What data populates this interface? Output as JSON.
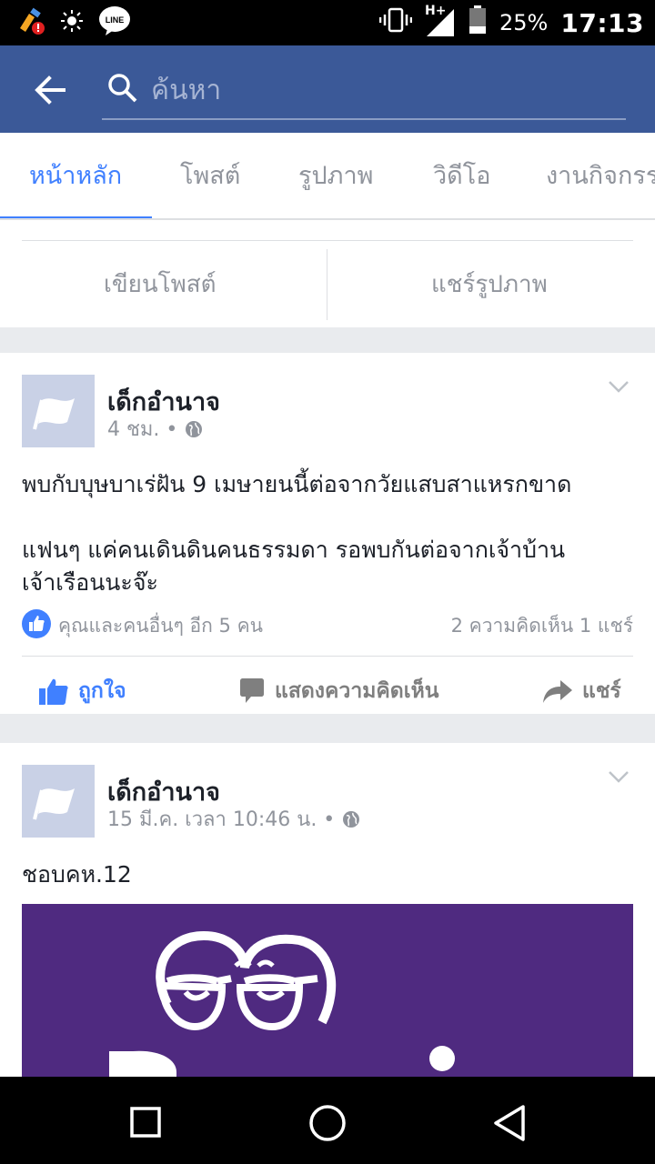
{
  "status_bar": {
    "battery": "25%",
    "time": "17:13",
    "network": "H+",
    "line_badge": "LINE"
  },
  "search": {
    "placeholder": "ค้นหา"
  },
  "tabs": [
    {
      "label": "หน้าหลัก",
      "active": true
    },
    {
      "label": "โพสต์",
      "active": false
    },
    {
      "label": "รูปภาพ",
      "active": false
    },
    {
      "label": "วิดีโอ",
      "active": false
    },
    {
      "label": "งานกิจกรร",
      "active": false
    }
  ],
  "composer": {
    "write_post": "เขียนโพสต์",
    "share_photo": "แชร์รูปภาพ"
  },
  "posts": [
    {
      "author": "เด็กอำนาจ",
      "time": "4 ชม. •",
      "line1": "พบกับบุษบาเร่ฝัน 9 เมษายนนี้ต่อจากวัยแสบสาแหรกขาด",
      "line2": "แฟนๆ แค่คนเดินดินคนธรรมดา รอพบกันต่อจากเจ้าบ้าน",
      "line3": "เจ้าเรือนนะจ๊ะ",
      "reactions": "คุณและคนอื่นๆ อีก 5 คน",
      "counts": "2 ความคิดเห็น 1 แชร์",
      "like_label": "ถูกใจ",
      "comment_label": "แสดงความคิดเห็น",
      "share_label": "แชร์"
    },
    {
      "author": "เด็กอำนาจ",
      "time": "15 มี.ค. เวลา 10:46 น. •",
      "text": "ชอบคห.12"
    }
  ],
  "colors": {
    "brand": "#3b5998",
    "accent": "#4080ff",
    "image_bg": "#4f2a80"
  }
}
